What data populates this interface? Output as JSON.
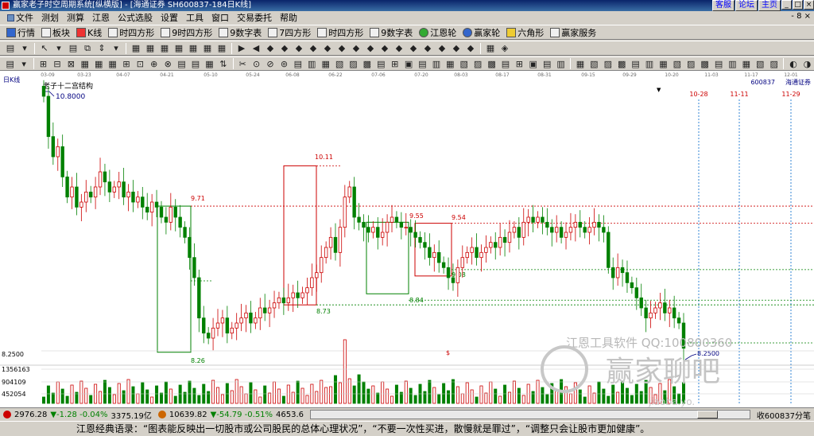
{
  "window": {
    "title": "赢家老子时空周期系统[纵横版] - [海通证券  SH600837-184日K线]",
    "buttons": [
      "客服",
      "论坛",
      "主页"
    ]
  },
  "menu": {
    "items": [
      "文件",
      "测划",
      "测算",
      "江恩",
      "公式选股",
      "设置",
      "工具",
      "窗口",
      "交易委托",
      "帮助"
    ],
    "right_caption": "- 8 ×"
  },
  "toolbar1": {
    "items": [
      {
        "label": "行情",
        "icon": "grid-icon"
      },
      {
        "label": "板块",
        "icon": "blocks-icon"
      },
      {
        "label": "K线",
        "icon": "kline-icon"
      },
      {
        "label": "时四方形",
        "icon": "time-square-icon"
      },
      {
        "label": "9时四方形",
        "icon": "nine-time-square-icon"
      },
      {
        "label": "9数字表",
        "icon": "nine-number-table-icon"
      },
      {
        "label": "7四方形",
        "icon": "seven-square-icon"
      },
      {
        "label": "时四方形",
        "icon": "time-square-icon"
      },
      {
        "label": "9数字表",
        "icon": "nine-number-table-icon"
      },
      {
        "label": "江恩轮",
        "icon": "gann-wheel-icon"
      },
      {
        "label": "赢家轮",
        "icon": "winner-wheel-icon"
      },
      {
        "label": "六角形",
        "icon": "hexagon-icon"
      },
      {
        "label": "赢家服务",
        "icon": "service-icon"
      }
    ]
  },
  "chart": {
    "period_label": "日K线",
    "chart_title": "老子十二宫结构",
    "stock_code": "600837",
    "stock_name": "海通证券",
    "dropdown_marker": "▼",
    "watermark_tool": "江恩工具软件  QQ:100800360",
    "watermark_brand": "赢家聊吧",
    "watermark_domain": "jiaoba.yo.",
    "dollar_marker": "$"
  },
  "chart_data": {
    "type": "candlestick",
    "date_ticks": [
      "03-09",
      "03-23",
      "04-07",
      "04-21",
      "05-10",
      "05-24",
      "06-08",
      "06-22",
      "07-06",
      "07-20",
      "08-03",
      "08-17",
      "08-31",
      "09-15",
      "09-29",
      "10-20",
      "11-03",
      "11-17",
      "12-01"
    ],
    "future_markers": [
      "10-28",
      "11-11",
      "11-29"
    ],
    "price_annotations": [
      {
        "label": "10.8000"
      },
      {
        "label": "10.11"
      },
      {
        "label": "9.71"
      },
      {
        "label": "9.55"
      },
      {
        "label": "9.54"
      },
      {
        "label": "9.08"
      },
      {
        "label": "8.84"
      },
      {
        "label": "8.73"
      },
      {
        "label": "8.26"
      },
      {
        "label": "8.2500"
      },
      {
        "label": "8.2500"
      }
    ],
    "volume_axis": [
      "1356163",
      "904109",
      "452054"
    ],
    "y_range": [
      8.0,
      11.0
    ],
    "colors": {
      "up": "#cc0000",
      "down": "#008000",
      "box_green": "#008000",
      "box_red": "#cc0000",
      "future_line": "#0066cc"
    }
  },
  "status": {
    "sh_index": "2976.28",
    "sh_change": "▼-1.28 -0.04%",
    "sh_amount": "3375.19亿",
    "sz_index": "10639.82",
    "sz_change": "▼-54.79 -0.51%",
    "sz_amount": "4653.6",
    "receive": "收600837分笔"
  },
  "quote": {
    "text": "江恩经典语录：“图表能反映出一切股市或公司股民的总体心理状况”，“不要一次性买进，散慢就是罪过”，“调整只会让股市更加健康”。"
  }
}
